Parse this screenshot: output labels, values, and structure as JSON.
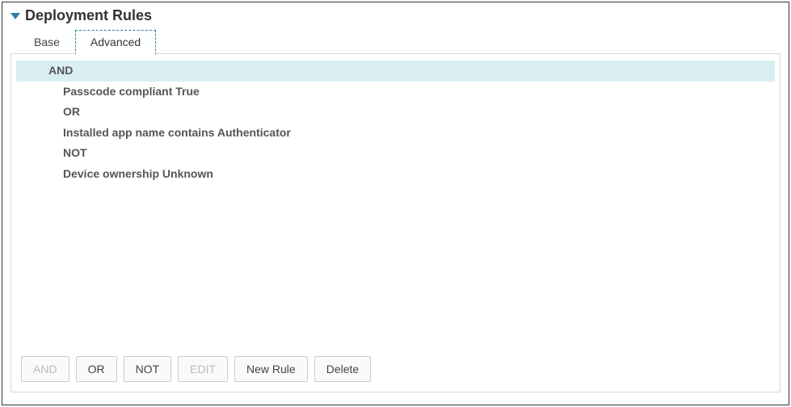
{
  "title": "Deployment Rules",
  "tabs": {
    "base": "Base",
    "advanced": "Advanced"
  },
  "rules": [
    {
      "text": "AND",
      "selected": true,
      "indent": false
    },
    {
      "text": "Passcode compliant True",
      "selected": false,
      "indent": true
    },
    {
      "text": "OR",
      "selected": false,
      "indent": true
    },
    {
      "text": "Installed app name contains Authenticator",
      "selected": false,
      "indent": true
    },
    {
      "text": "NOT",
      "selected": false,
      "indent": true
    },
    {
      "text": "Device ownership Unknown",
      "selected": false,
      "indent": true
    }
  ],
  "buttons": {
    "and": "AND",
    "or": "OR",
    "not": "NOT",
    "edit": "EDIT",
    "newRule": "New Rule",
    "delete": "Delete"
  }
}
